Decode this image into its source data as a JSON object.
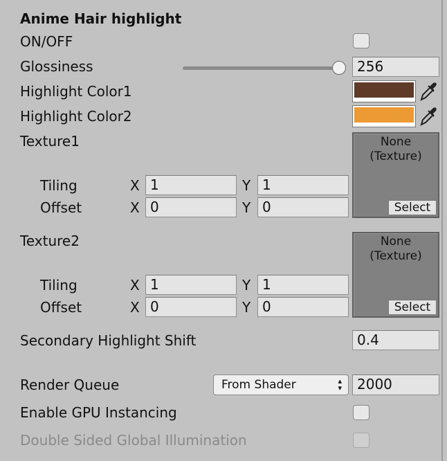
{
  "header": {
    "title": "Anime Hair highlight"
  },
  "onoff": {
    "label": "ON/OFF",
    "checked": false
  },
  "glossiness": {
    "label": "Glossiness",
    "value": "256",
    "slider_fraction": 1.0
  },
  "highlight1": {
    "label": "Highlight Color1",
    "color": "#5f3a29"
  },
  "highlight2": {
    "label": "Highlight Color2",
    "color": "#ec9a34"
  },
  "texture1": {
    "label": "Texture1",
    "slot_line1": "None",
    "slot_line2": "(Texture)",
    "select_label": "Select",
    "tiling": {
      "label": "Tiling",
      "x_label": "X",
      "x": "1",
      "y_label": "Y",
      "y": "1"
    },
    "offset": {
      "label": "Offset",
      "x_label": "X",
      "x": "0",
      "y_label": "Y",
      "y": "0"
    }
  },
  "texture2": {
    "label": "Texture2",
    "slot_line1": "None",
    "slot_line2": "(Texture)",
    "select_label": "Select",
    "tiling": {
      "label": "Tiling",
      "x_label": "X",
      "x": "1",
      "y_label": "Y",
      "y": "1"
    },
    "offset": {
      "label": "Offset",
      "x_label": "X",
      "x": "0",
      "y_label": "Y",
      "y": "0"
    }
  },
  "secondary_shift": {
    "label": "Secondary Highlight Shift",
    "value": "0.4"
  },
  "render_queue": {
    "label": "Render Queue",
    "dropdown_value": "From Shader",
    "value": "2000"
  },
  "gpu_instancing": {
    "label": "Enable GPU Instancing",
    "checked": false
  },
  "double_sided_gi": {
    "label": "Double Sided Global Illumination",
    "checked": false,
    "disabled": true
  },
  "icons": {
    "picker": "eyedropper-icon",
    "dropdown_arrow": "updown-arrows-icon"
  }
}
